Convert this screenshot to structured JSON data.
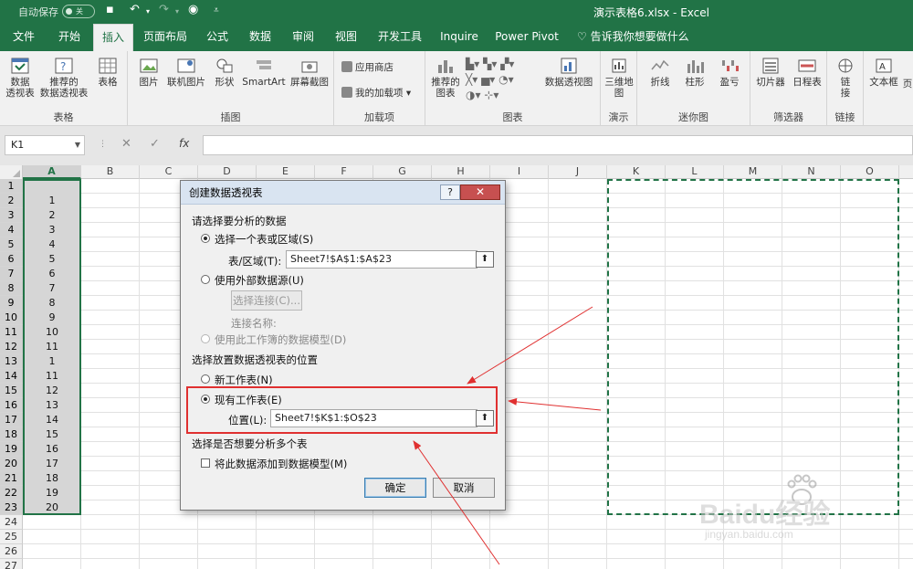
{
  "titlebar": {
    "autosave_label": "自动保存",
    "autosave_state": "关",
    "doc_title": "演示表格6.xlsx  -  Excel"
  },
  "tabs": [
    {
      "label": "文件"
    },
    {
      "label": "开始"
    },
    {
      "label": "插入",
      "active": true
    },
    {
      "label": "页面布局"
    },
    {
      "label": "公式"
    },
    {
      "label": "数据"
    },
    {
      "label": "审阅"
    },
    {
      "label": "视图"
    },
    {
      "label": "开发工具"
    },
    {
      "label": "Inquire"
    },
    {
      "label": "Power Pivot"
    }
  ],
  "tell_me": "告诉我你想要做什么",
  "ribbon": {
    "groups": {
      "tables": "表格",
      "illustrations": "插图",
      "addins": "加载项",
      "charts": "图表",
      "tours": "演示",
      "sparklines": "迷你图",
      "filters": "筛选器",
      "links": "链接"
    },
    "buttons": {
      "pivot_table": [
        "数据",
        "透视表"
      ],
      "recommended_pivot": [
        "推荐的",
        "数据透视表"
      ],
      "table": "表格",
      "pictures": "图片",
      "online_pictures": "联机图片",
      "shapes": "形状",
      "smartart": "SmartArt",
      "screenshot": "屏幕截图",
      "store": "应用商店",
      "my_addins": "我的加载项",
      "recommended_charts": [
        "推荐的",
        "图表"
      ],
      "pivot_chart": "数据透视图",
      "map_3d": [
        "三维地",
        "图"
      ],
      "line": "折线",
      "column": "柱形",
      "win_loss": "盈亏",
      "slicer": "切片器",
      "timeline": "日程表",
      "link": [
        "链",
        "接"
      ],
      "textbox": "文本框",
      "more": "页"
    }
  },
  "formula_bar": {
    "name_box": "K1",
    "fx": "fx",
    "formula": ""
  },
  "grid": {
    "columns": [
      "A",
      "B",
      "C",
      "D",
      "E",
      "F",
      "G",
      "H",
      "I",
      "J",
      "K",
      "L",
      "M",
      "N",
      "O"
    ],
    "rows": [
      "1",
      "2",
      "3",
      "4",
      "5",
      "6",
      "7",
      "8",
      "9",
      "10",
      "11",
      "12",
      "13",
      "14",
      "15",
      "16",
      "17",
      "18",
      "19",
      "20",
      "21",
      "22",
      "23",
      "24",
      "25",
      "26",
      "27"
    ],
    "colA_values": [
      "",
      "1",
      "2",
      "3",
      "4",
      "5",
      "6",
      "7",
      "8",
      "9",
      "10",
      "11",
      "1",
      "11",
      "12",
      "13",
      "14",
      "15",
      "16",
      "17",
      "18",
      "19",
      "20"
    ]
  },
  "dialog": {
    "title": "创建数据透视表",
    "help": "?",
    "close": "✕",
    "section1": "请选择要分析的数据",
    "opt_table_range": "选择一个表或区域(S)",
    "range_label": "表/区域(T):",
    "range_value": "Sheet7!$A$1:$A$23",
    "opt_external": "使用外部数据源(U)",
    "choose_connection": "选择连接(C)...",
    "connection_name": "连接名称:",
    "opt_data_model": "使用此工作簿的数据模型(D)",
    "section2": "选择放置数据透视表的位置",
    "opt_new_sheet": "新工作表(N)",
    "opt_existing_sheet": "现有工作表(E)",
    "location_label": "位置(L):",
    "location_value": "Sheet7!$K$1:$O$23",
    "section3": "选择是否想要分析多个表",
    "add_to_model": "将此数据添加到数据模型(M)",
    "ok": "确定",
    "cancel": "取消"
  },
  "watermark": {
    "brand": "Baidu经验",
    "url": "jingyan.baidu.com"
  },
  "colors": {
    "excel_green": "#217346",
    "highlight_red": "#e03030"
  }
}
